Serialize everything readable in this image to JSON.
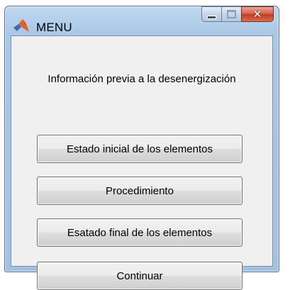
{
  "window": {
    "title": "MENU",
    "icon": "matlab-logo-icon",
    "controls": {
      "minimize": "minimize-icon",
      "maximize": "maximize-icon",
      "close": "close-icon"
    }
  },
  "content": {
    "info_label": "Información previa a la desenergización",
    "buttons": {
      "initial_state": "Estado inicial de los elementos",
      "procedure": "Procedimiento",
      "final_state": "Esatado final de los elementos",
      "continue": "Continuar"
    }
  }
}
